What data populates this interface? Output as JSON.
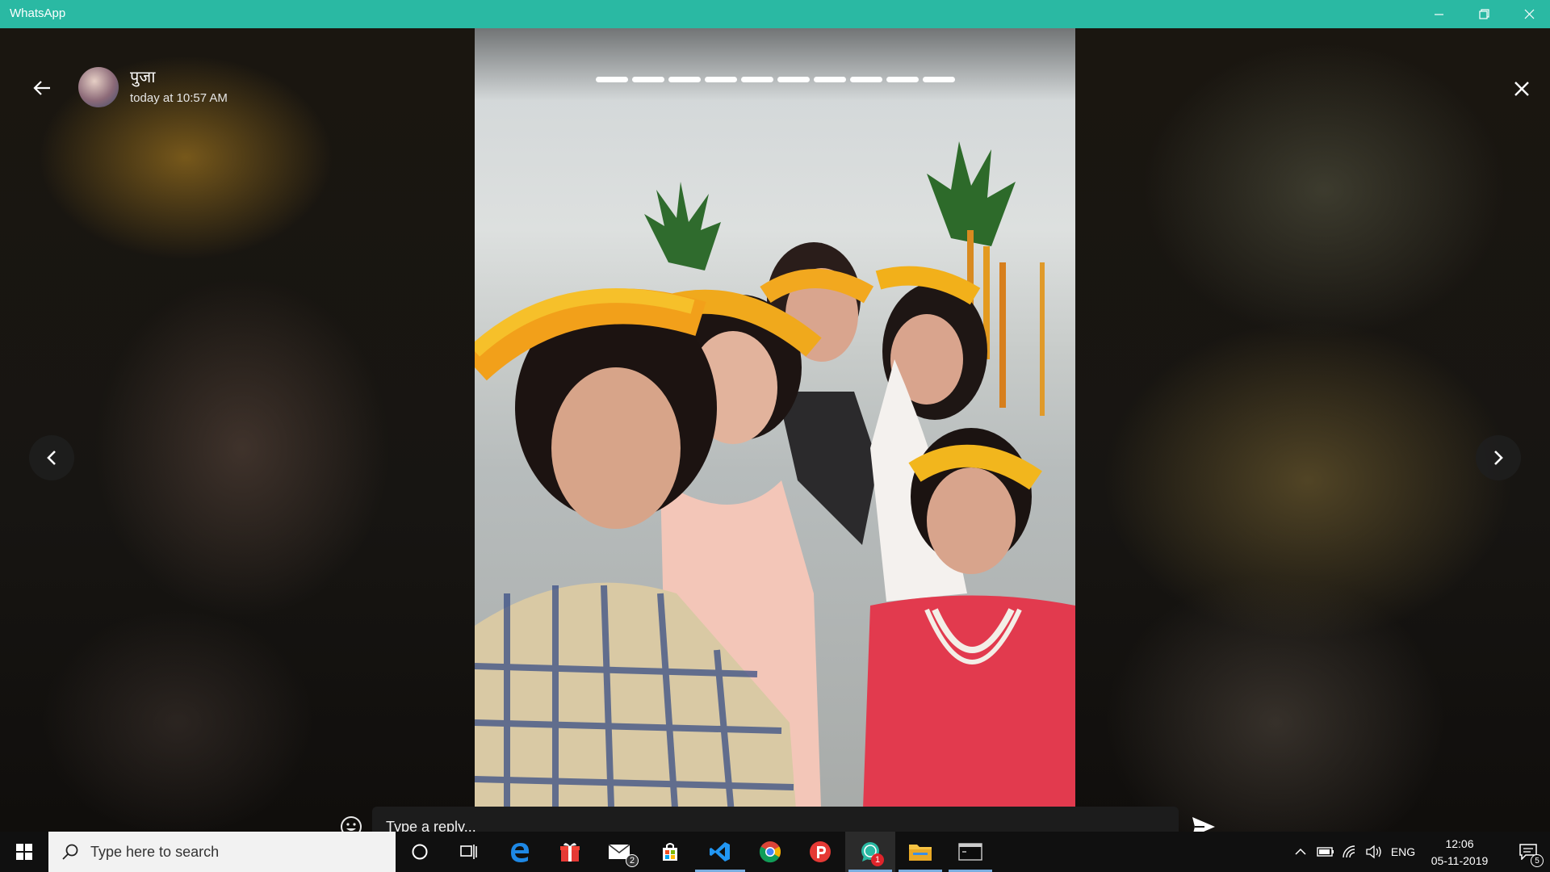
{
  "window": {
    "title": "WhatsApp",
    "controls": [
      "minimize-icon",
      "restore-icon",
      "close-icon"
    ]
  },
  "status_viewer": {
    "contact_name": "पुजा",
    "timestamp": "today at 10:57 AM",
    "progress_segments": 10,
    "reply_placeholder": "Type a reply...",
    "icons": [
      "back-arrow-icon",
      "close-icon",
      "chevron-left-icon",
      "chevron-right-icon",
      "emoji-icon",
      "send-icon"
    ]
  },
  "taskbar": {
    "search_placeholder": "Type here to search",
    "apps": [
      {
        "name": "cortana",
        "icon": "circle-icon"
      },
      {
        "name": "task-view",
        "icon": "task-view-icon"
      },
      {
        "name": "edge",
        "icon": "edge-icon"
      },
      {
        "name": "gift",
        "icon": "gift-icon"
      },
      {
        "name": "mail",
        "icon": "mail-icon",
        "badge": "2"
      },
      {
        "name": "store",
        "icon": "store-icon"
      },
      {
        "name": "vscode",
        "icon": "vscode-icon"
      },
      {
        "name": "chrome",
        "icon": "chrome-icon"
      },
      {
        "name": "psiphon",
        "icon": "p-icon"
      },
      {
        "name": "whatsapp",
        "icon": "whatsapp-icon",
        "badge": "1"
      },
      {
        "name": "file-explorer",
        "icon": "folder-icon"
      },
      {
        "name": "terminal",
        "icon": "terminal-icon"
      }
    ],
    "tray": {
      "language": "ENG",
      "time": "12:06",
      "date": "05-11-2019",
      "notification_count": "5"
    },
    "colors": {
      "accent": "#2ab9a3",
      "whatsapp_badge": "#e0242b"
    }
  }
}
